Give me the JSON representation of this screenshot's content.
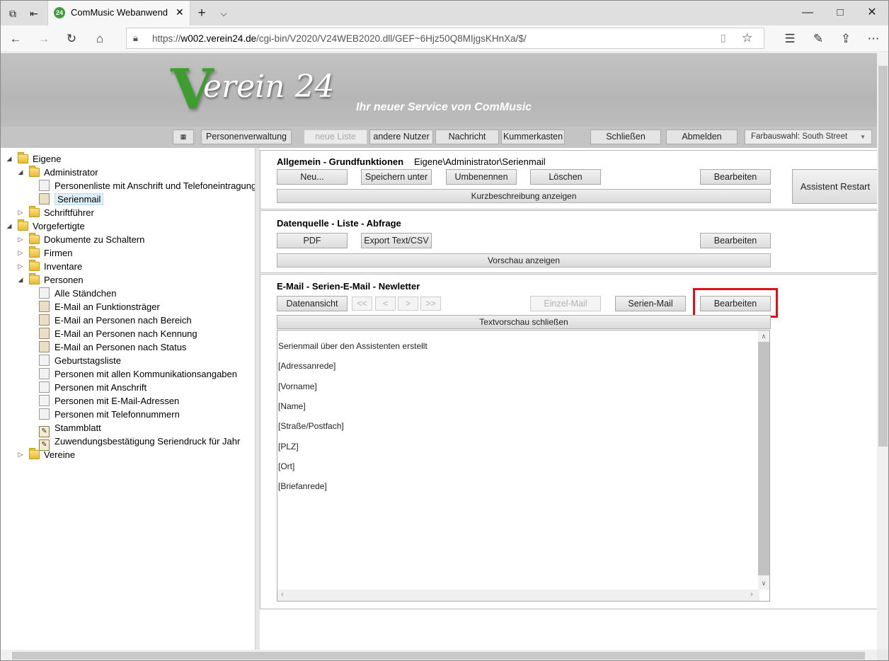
{
  "browser": {
    "tab_title": "ComMusic Webanwend",
    "favicon_text": "24",
    "url_prefix": "https://",
    "url_domain": "w002.verein24.de",
    "url_path": "/cgi-bin/V2020/V24WEB2020.dll/GEF~6Hjz50Q8MIjgsKHnXa/$/"
  },
  "header": {
    "logo_v": "V",
    "logo_rest": "erein 24",
    "slogan": "Ihr neuer Service von ComMusic",
    "buttons": {
      "personenverwaltung": "Personenverwaltung",
      "neue_liste": "neue Liste",
      "andere_nutzer": "andere Nutzer",
      "nachricht": "Nachricht",
      "kummerkasten": "Kummerkasten",
      "schliessen": "Schließen",
      "abmelden": "Abmelden"
    },
    "farbauswahl": "Farbauswahl: South Street"
  },
  "tree": {
    "eigene": "Eigene",
    "administrator": "Administrator",
    "personenliste": "Personenliste mit Anschrift und Telefoneintragungen",
    "serienmail": "Serienmail",
    "schriftfuehrer": "Schriftführer",
    "vorgefertigte": "Vorgefertigte",
    "dokumente": "Dokumente zu Schaltern",
    "firmen": "Firmen",
    "inventare": "Inventare",
    "personen": "Personen",
    "items": [
      "Alle Ständchen",
      "E-Mail an Funktionsträger",
      "E-Mail an Personen nach Bereich",
      "E-Mail an Personen nach Kennung",
      "E-Mail an Personen nach Status",
      "Geburtstagsliste",
      "Personen mit allen Kommunikationsangaben",
      "Personen mit Anschrift",
      "Personen mit E-Mail-Adressen",
      "Personen mit Telefonnummern",
      "Stammblatt",
      "Zuwendungsbestätigung Seriendruck für Jahr"
    ],
    "vereine": "Vereine"
  },
  "panel1": {
    "title": "Allgemein - Grundfunktionen",
    "path": "Eigene\\Administrator\\Serienmail",
    "neu": "Neu...",
    "speichern_unter": "Speichern unter",
    "umbenennen": "Umbenennen",
    "loeschen": "Löschen",
    "bearbeiten": "Bearbeiten",
    "kurzbeschreibung": "Kurzbeschreibung anzeigen",
    "assistent_restart": "Assistent Restart"
  },
  "panel2": {
    "title": "Datenquelle - Liste - Abfrage",
    "pdf": "PDF",
    "export": "Export Text/CSV",
    "bearbeiten": "Bearbeiten",
    "vorschau": "Vorschau anzeigen"
  },
  "panel3": {
    "title": "E-Mail - Serien-E-Mail - Newletter",
    "datenansicht": "Datenansicht",
    "first": "<<",
    "prev": "<",
    "next": ">",
    "last": ">>",
    "einzel_mail": "Einzel-Mail",
    "serien_mail": "Serien-Mail",
    "bearbeiten": "Bearbeiten",
    "textvorschau": "Textvorschau schließen",
    "text_lines": [
      "Serienmail über den Assistenten erstellt",
      "[Adressanrede]",
      "[Vorname]",
      "[Name]",
      "[Straße/Postfach]",
      "[PLZ]",
      "[Ort]",
      "[Briefanrede]"
    ]
  }
}
